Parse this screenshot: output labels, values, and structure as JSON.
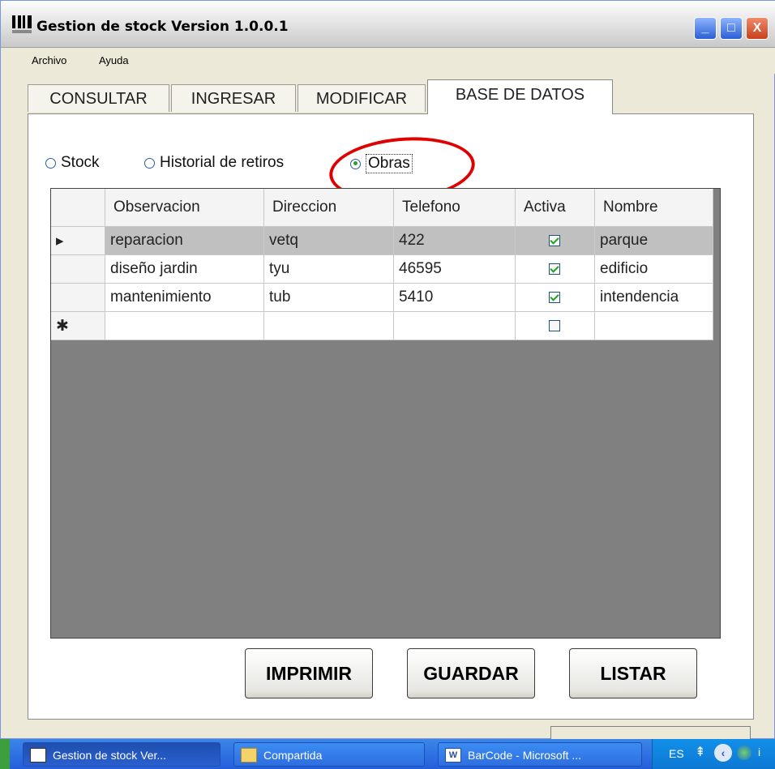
{
  "window": {
    "title": "Gestion de stock Version 1.0.0.1",
    "controls": [
      "_",
      "□",
      "X"
    ]
  },
  "menu": {
    "items": [
      "Archivo",
      "Ayuda"
    ]
  },
  "tabs": [
    "CONSULTAR",
    "INGRESAR",
    "MODIFICAR",
    "BASE DE DATOS"
  ],
  "active_tab": "BASE DE DATOS",
  "radios": [
    {
      "label": "Stock",
      "checked": false
    },
    {
      "label": "Historial de retiros",
      "checked": false
    },
    {
      "label": "Obras",
      "checked": true
    }
  ],
  "grid": {
    "columns": [
      "Observacion",
      "Direccion",
      "Telefono",
      "Activa",
      "Nombre"
    ],
    "rows": [
      {
        "marker": "▸",
        "observacion": "reparacion",
        "direccion": "vetq",
        "telefono": "422",
        "activa": true,
        "nombre": "parque"
      },
      {
        "marker": "",
        "observacion": "diseño jardin",
        "direccion": "tyu",
        "telefono": "46595",
        "activa": true,
        "nombre": "edificio"
      },
      {
        "marker": "",
        "observacion": "mantenimiento",
        "direccion": "tub",
        "telefono": "5410",
        "activa": true,
        "nombre": "intendencia"
      },
      {
        "marker": "✱",
        "observacion": "",
        "direccion": "",
        "telefono": "",
        "activa": false,
        "nombre": ""
      }
    ]
  },
  "buttons": {
    "print": "IMPRIMIR",
    "save": "GUARDAR",
    "list": "LISTAR"
  },
  "taskbar": {
    "items": [
      "Gestion de stock Ver...",
      "Compartida",
      "BarCode - Microsoft ..."
    ],
    "tray": {
      "language": "ES"
    }
  },
  "colors": {
    "highlight": "#e00000",
    "taskbar": "#245edb",
    "grid_background": "#808080"
  }
}
